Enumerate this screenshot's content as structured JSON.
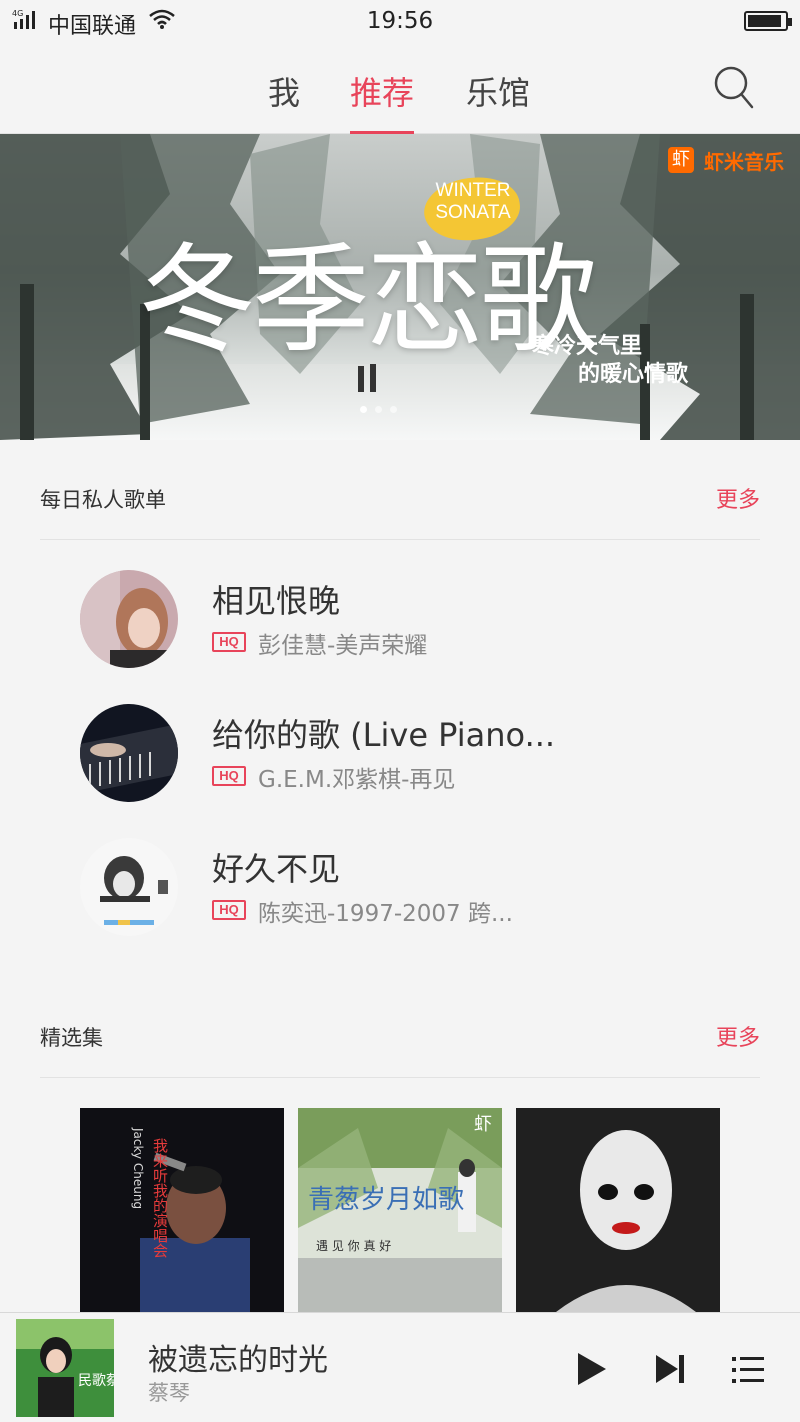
{
  "status_bar": {
    "network": "4G",
    "carrier": "中国联通",
    "time": "19:56",
    "icons": [
      "signal-icon",
      "wifi-icon",
      "battery-icon"
    ]
  },
  "nav": {
    "tabs": [
      {
        "label": "我",
        "active": false
      },
      {
        "label": "推荐",
        "active": true
      },
      {
        "label": "乐馆",
        "active": false
      }
    ],
    "search_icon": "search-icon",
    "accent_color": "#e8445a"
  },
  "banner": {
    "brand": "虾米音乐",
    "brand_logo": "虾",
    "badge_line1": "WINTER",
    "badge_line2": "SONATA",
    "headline": "冬季恋歌",
    "subtitle_line1": "寒冷天气里",
    "subtitle_line2": "的暖心情歌",
    "brand_color": "#ff6a00"
  },
  "daily": {
    "title": "每日私人歌单",
    "more": "更多",
    "songs": [
      {
        "name": "相见恨晚",
        "quality": "HQ",
        "artist": "彭佳慧-美声荣耀"
      },
      {
        "name": "给你的歌 (Live Piano...",
        "quality": "HQ",
        "artist": "G.E.M.邓紫棋-再见"
      },
      {
        "name": "好久不见",
        "quality": "HQ",
        "artist": "陈奕迅-1997-2007 跨..."
      }
    ]
  },
  "featured": {
    "title": "精选集",
    "more": "更多",
    "albums": [
      {
        "cover_text_vertical": "我来听我的演唱会",
        "cover_text_side": "Jacky Cheung"
      },
      {
        "cover_title": "青葱岁月如歌",
        "cover_subtitle": "遇 见 你 真 好",
        "logo": "虾"
      },
      {}
    ]
  },
  "player": {
    "title": "被遗忘的时光",
    "artist": "蔡琴",
    "cover_text": "民歌蔡琴",
    "controls": [
      "play-icon",
      "next-icon",
      "playlist-icon"
    ]
  }
}
